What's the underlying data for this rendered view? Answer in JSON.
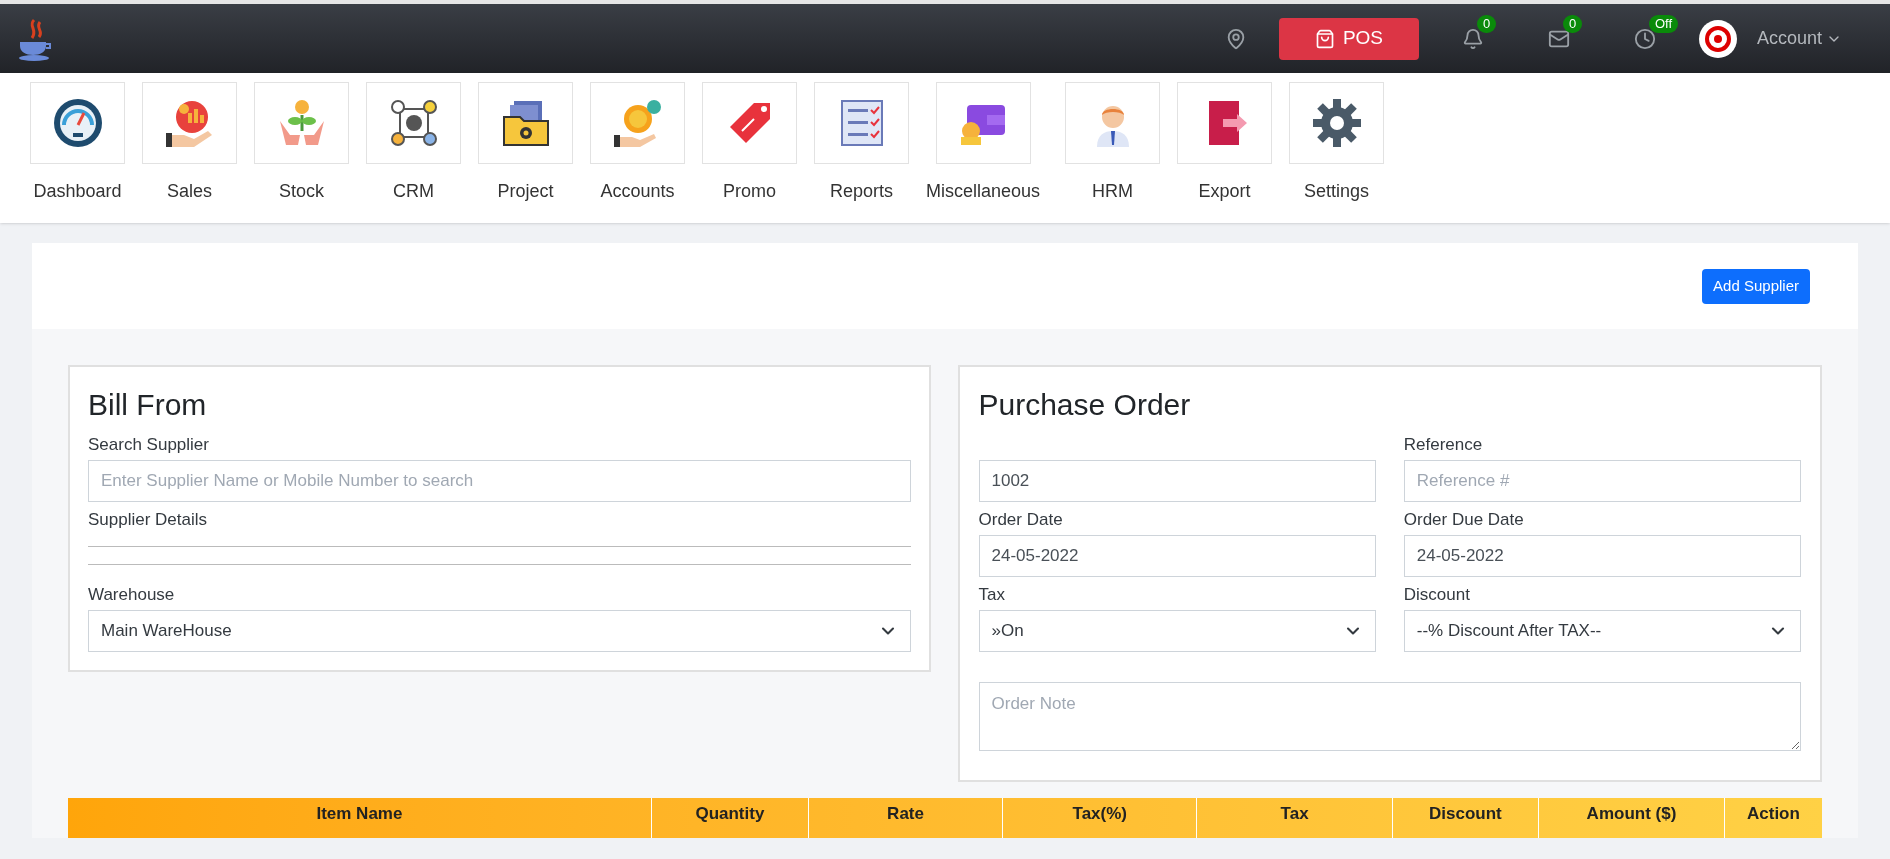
{
  "topbar": {
    "pos_label": "POS",
    "notifications": "0",
    "messages": "0",
    "clock_status": "Off",
    "account_label": "Account"
  },
  "nav": [
    {
      "label": "Dashboard"
    },
    {
      "label": "Sales"
    },
    {
      "label": "Stock"
    },
    {
      "label": "CRM"
    },
    {
      "label": "Project"
    },
    {
      "label": "Accounts"
    },
    {
      "label": "Promo"
    },
    {
      "label": "Reports"
    },
    {
      "label": "Miscellaneous"
    },
    {
      "label": "HRM"
    },
    {
      "label": "Export"
    },
    {
      "label": "Settings"
    }
  ],
  "add_supplier_button": "Add Supplier",
  "bill_from": {
    "title": "Bill From",
    "search_label": "Search Supplier",
    "search_placeholder": "Enter Supplier Name or Mobile Number to search",
    "details_label": "Supplier Details",
    "warehouse_label": "Warehouse",
    "warehouse_value": "Main WareHouse"
  },
  "purchase_order": {
    "title": "Purchase Order",
    "order_number": "1002",
    "reference_label": "Reference",
    "reference_placeholder": "Reference #",
    "order_date_label": "Order Date",
    "order_date": "24-05-2022",
    "due_date_label": "Order Due Date",
    "due_date": "24-05-2022",
    "tax_label": "Tax",
    "tax_value": "»On",
    "discount_label": "Discount",
    "discount_value": "--% Discount After TAX--",
    "note_placeholder": "Order Note"
  },
  "table": {
    "columns": [
      "Item Name",
      "Quantity",
      "Rate",
      "Tax(%)",
      "Tax",
      "Discount",
      "Amount ($)",
      "Action"
    ]
  }
}
